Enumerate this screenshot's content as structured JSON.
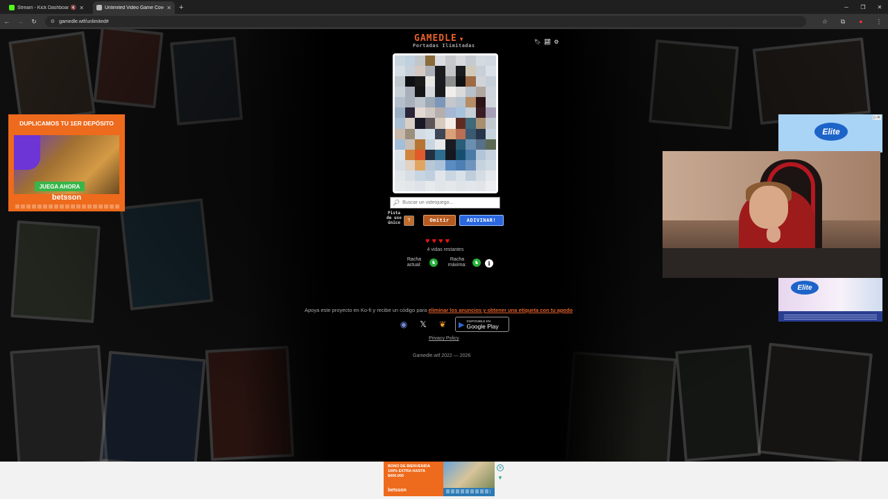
{
  "browser": {
    "tabs": [
      {
        "title": "Stream - Kick Dashboard",
        "favicon_color": "#53fc18",
        "active": false,
        "muted": true
      },
      {
        "title": "Unlimited Video Game Cover G",
        "favicon_color": "#bbbbbb",
        "active": true,
        "muted": false
      }
    ],
    "url": "gamedle.wtf/unlimited#"
  },
  "game": {
    "logo": "GAMEDLE",
    "subtitle": "Portadas Ilimitadas",
    "search_placeholder": "Buscar un videojuego...",
    "hint_label": "Pista de uso único",
    "skip_label": "Omitir",
    "guess_label": "ADIVINAR!",
    "lives_total": 4,
    "lives_text": "4 vidas restantes",
    "current_streak_label": "Racha actual:",
    "max_streak_label": "Racha máxima:",
    "cover_pixels": [
      "#c9d6df",
      "#bfd0de",
      "#c2c5c9",
      "#8a6b3a",
      "#d9dbe0",
      "#c7c8ca",
      "#d6d8dc",
      "#c5cad0",
      "#d3dae0",
      "#cfd8e0",
      "#d5dde5",
      "#c7d0d8",
      "#d4c9c2",
      "#aeb2b8",
      "#1b1b1d",
      "#c3c5c7",
      "#1c1c1e",
      "#d1c9b8",
      "#c8cfd8",
      "#d9e0e7",
      "#bfc7cf",
      "#0f1012",
      "#1a1a1b",
      "#e7e6e3",
      "#191b20",
      "#8d8f8e",
      "#111214",
      "#9d6a43",
      "#d0d4d8",
      "#c6ced7",
      "#c8d0d8",
      "#aab0b9",
      "#161515",
      "#d5d8dd",
      "#191a1c",
      "#f0eeea",
      "#d9dad9",
      "#b8c0ca",
      "#b1a7a1",
      "#ccd3da",
      "#b3bfcd",
      "#a8b0ba",
      "#bcc3cb",
      "#9ca9b6",
      "#7d97ba",
      "#c5c7cb",
      "#b5c2cf",
      "#b58d67",
      "#2d1418",
      "#d0d5da",
      "#9cb0c4",
      "#2a2438",
      "#e4d8d3",
      "#cfc7c3",
      "#b5aeac",
      "#a6b7d6",
      "#a7c2dd",
      "#c7d0d6",
      "#3a1c24",
      "#a79fb8",
      "#a9bfd3",
      "#d9cfc5",
      "#1a1826",
      "#5d5557",
      "#d7cbc0",
      "#f3efe8",
      "#5f2c23",
      "#3e6a7a",
      "#aa8e70",
      "#c1c9cf",
      "#c9b9aa",
      "#9b8f7e",
      "#d5dbe2",
      "#d7e2eb",
      "#3c4654",
      "#d9a07a",
      "#b96f53",
      "#3a5a72",
      "#263548",
      "#c7d3dc",
      "#a3beda",
      "#c9bfb6",
      "#b67532",
      "#c9d6e2",
      "#e8e8e8",
      "#1a1b20",
      "#2a5c78",
      "#6a8fb0",
      "#577189",
      "#5c6a55",
      "#dde4ea",
      "#d2843c",
      "#e05a2c",
      "#243040",
      "#2e6d8e",
      "#15181e",
      "#164f6d",
      "#4a7aa6",
      "#b3c6d8",
      "#c5d2de",
      "#d7dee5",
      "#e0d2c5",
      "#e2a560",
      "#b8c7d6",
      "#aac2da",
      "#5a8cc4",
      "#4d7fb5",
      "#6f95be",
      "#c6d3df",
      "#d0dae3",
      "#e1e6ea",
      "#d8dee4",
      "#c7d5e2",
      "#bfcfde",
      "#dfe5ea",
      "#cad6e1",
      "#d8e0e8",
      "#c0cedc",
      "#d5dde4",
      "#e4e8ec",
      "#e6e9ec",
      "#e4e7ea",
      "#dde3e8",
      "#e7eaed",
      "#e0e5ea",
      "#e5e8eb",
      "#dfe4e9",
      "#e3e7eb",
      "#e1e5e9",
      "#ebeef0"
    ]
  },
  "footer": {
    "support_text": "Apoya este proyecto en Ko-fi y recibe un código para",
    "support_link": "eliminar los anuncios y obtener una etiqueta con tu apodo",
    "gplay_small": "DISPONIBLE EN",
    "gplay_big": "Google Play",
    "privacy": "Privacy Policy",
    "copyright": "Gamedle.wtf 2022 — 2026"
  },
  "ads": {
    "left_headline": "DUPLICAMOS TU 1ER DEPÓSITO",
    "left_cta": "JUEGA AHORA",
    "left_brand": "betsson",
    "right_brand": "Elite",
    "bottom_headline": "BONO DE BIENVENIDA 100% EXTRA HASTA $400.000",
    "bottom_brand": "betsson"
  }
}
